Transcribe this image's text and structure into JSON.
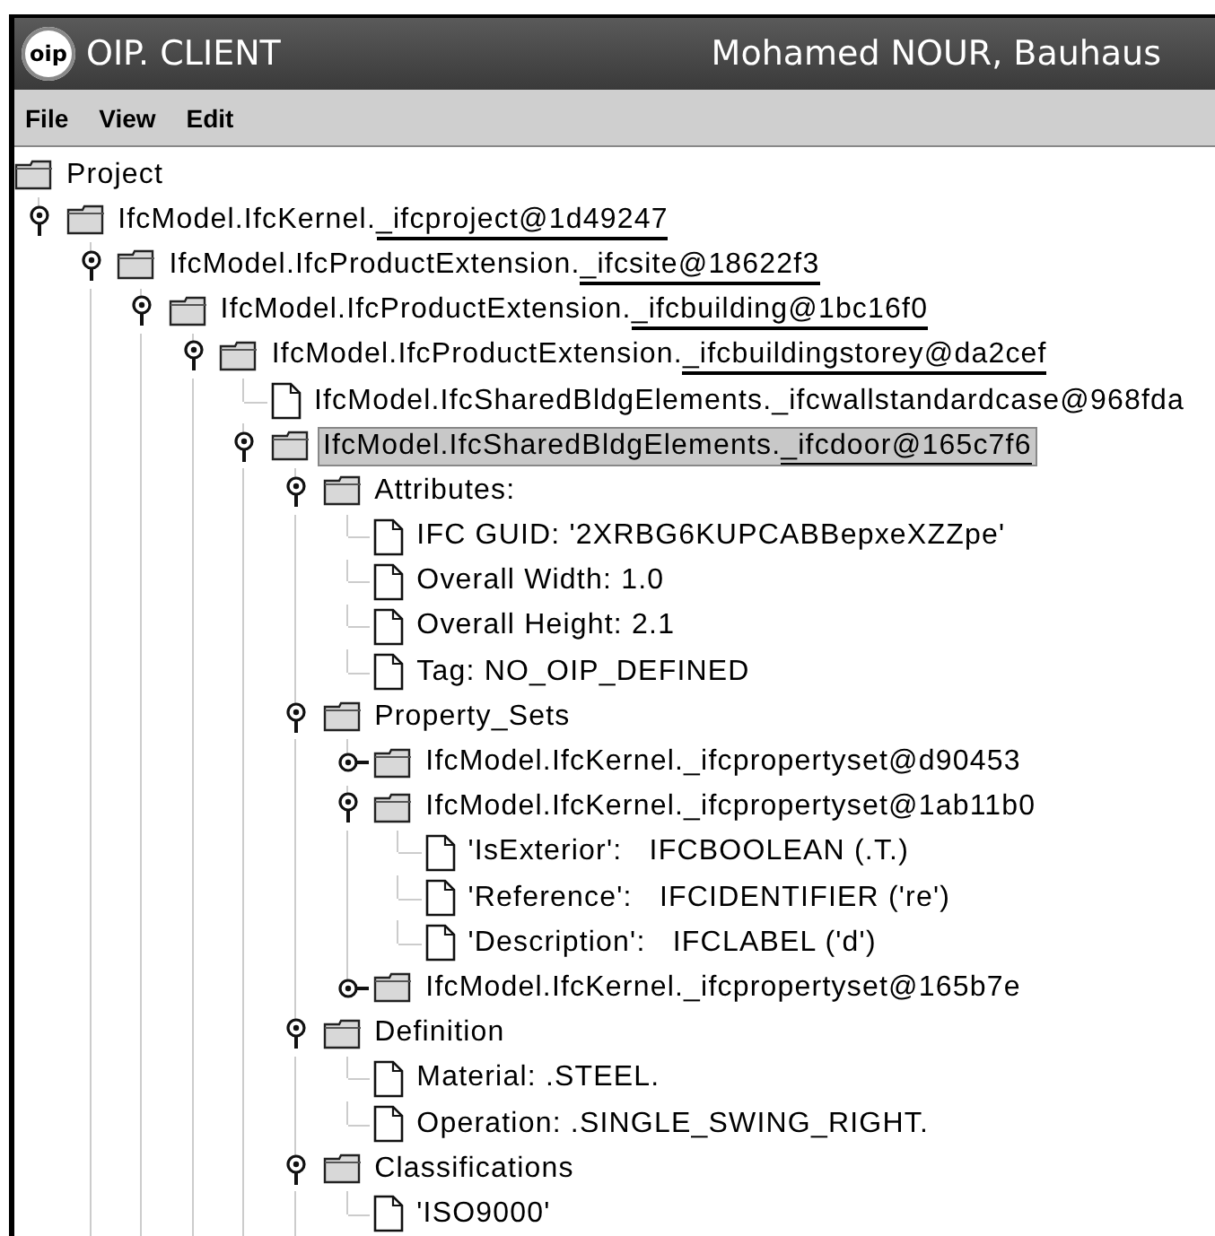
{
  "window": {
    "logo": "oip",
    "title": "OIP. CLIENT",
    "user": "Mohamed NOUR, Bauhaus"
  },
  "menu": [
    {
      "label": "File"
    },
    {
      "label": "View"
    },
    {
      "label": "Edit"
    }
  ],
  "tree": {
    "kind": "root",
    "prefix": "Project",
    "selected": false,
    "expanded": true,
    "children": [
      {
        "kind": "folder",
        "prefix": "IfcModel.IfcKernel.",
        "name": "_ifcproject@1d49247",
        "underlined": true,
        "selected": false,
        "expanded": true,
        "children": [
          {
            "kind": "folder",
            "prefix": "IfcModel.IfcProductExtension.",
            "name": "_ifcsite@18622f3",
            "underlined": true,
            "selected": false,
            "expanded": true,
            "children": [
              {
                "kind": "folder",
                "prefix": "IfcModel.IfcProductExtension.",
                "name": "_ifcbuilding@1bc16f0",
                "underlined": true,
                "selected": false,
                "expanded": true,
                "children": [
                  {
                    "kind": "folder",
                    "prefix": "IfcModel.IfcProductExtension.",
                    "name": "_ifcbuildingstorey@da2cef",
                    "underlined": true,
                    "selected": false,
                    "expanded": true,
                    "children": [
                      {
                        "kind": "leaf",
                        "prefix": "IfcModel.IfcSharedBldgElements.",
                        "name": "_ifcwallstandardcase@968fda",
                        "underlined": false,
                        "selected": false
                      },
                      {
                        "kind": "folder",
                        "prefix": "IfcModel.IfcSharedBldgElements.",
                        "name": "_ifcdoor@165c7f6",
                        "underlined": true,
                        "selected": true,
                        "expanded": true,
                        "children": [
                          {
                            "kind": "folder",
                            "prefix": "Attributes:",
                            "selected": false,
                            "expanded": true,
                            "children": [
                              {
                                "kind": "leaf",
                                "prefix": "IFC GUID: '2XRBG6KUPCABBepxeXZZpe'",
                                "selected": false
                              },
                              {
                                "kind": "leaf",
                                "prefix": "Overall Width: 1.0",
                                "selected": false
                              },
                              {
                                "kind": "leaf",
                                "prefix": "Overall Height: 2.1",
                                "selected": false
                              },
                              {
                                "kind": "leaf",
                                "prefix": "Tag: NO_OIP_DEFINED",
                                "selected": false
                              }
                            ]
                          },
                          {
                            "kind": "folder",
                            "prefix": "Property_Sets",
                            "selected": false,
                            "expanded": true,
                            "children": [
                              {
                                "kind": "folder",
                                "prefix": "IfcModel.IfcKernel._ifcpropertyset@d90453",
                                "selected": false,
                                "expanded": false
                              },
                              {
                                "kind": "folder",
                                "prefix": "IfcModel.IfcKernel._ifcpropertyset@1ab11b0",
                                "selected": false,
                                "expanded": true,
                                "children": [
                                  {
                                    "kind": "leaf",
                                    "prefix": "'IsExterior':   IFCBOOLEAN (.T.)",
                                    "selected": false
                                  },
                                  {
                                    "kind": "leaf",
                                    "prefix": "'Reference':   IFCIDENTIFIER ('re')",
                                    "selected": false
                                  },
                                  {
                                    "kind": "leaf",
                                    "prefix": "'Description':   IFCLABEL ('d')",
                                    "selected": false
                                  }
                                ]
                              },
                              {
                                "kind": "folder",
                                "prefix": "IfcModel.IfcKernel._ifcpropertyset@165b7e",
                                "selected": false,
                                "expanded": false
                              }
                            ]
                          },
                          {
                            "kind": "folder",
                            "prefix": "Definition",
                            "selected": false,
                            "expanded": true,
                            "children": [
                              {
                                "kind": "leaf",
                                "prefix": "Material: .STEEL.",
                                "selected": false
                              },
                              {
                                "kind": "leaf",
                                "prefix": "Operation: .SINGLE_SWING_RIGHT.",
                                "selected": false
                              }
                            ]
                          },
                          {
                            "kind": "folder",
                            "prefix": "Classifications",
                            "selected": false,
                            "expanded": true,
                            "children": [
                              {
                                "kind": "leaf",
                                "prefix": "'ISO9000'",
                                "selected": false
                              }
                            ]
                          }
                        ]
                      }
                    ]
                  }
                ]
              }
            ]
          }
        ]
      }
    ]
  }
}
